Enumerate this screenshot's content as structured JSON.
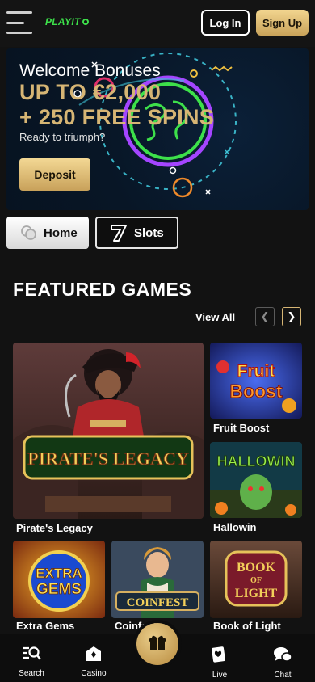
{
  "header": {
    "logo_text": "PLAYIT",
    "login_label": "Log In",
    "signup_label": "Sign Up"
  },
  "banner": {
    "welcome": "Welcome Bonuses",
    "amount": "UP TO €2,000",
    "spins": "+ 250 FREE SPINS",
    "tagline": "Ready to triumph?",
    "deposit_label": "Deposit"
  },
  "tabs": [
    {
      "label": "Home",
      "icon": "chips-icon",
      "active": true
    },
    {
      "label": "Slots",
      "icon": "seven-icon",
      "active": false
    }
  ],
  "featured": {
    "title": "FEATURED GAMES",
    "view_all": "View All",
    "games": [
      {
        "name": "Pirate's Legacy",
        "art_text": "PIRATE'S LEGACY"
      },
      {
        "name": "Fruit Boost",
        "art_text": "Fruit Boost"
      },
      {
        "name": "Hallowin",
        "art_text": "HALLOWIN"
      },
      {
        "name": "Extra Gems",
        "art_text": "EXTRA GEMS"
      },
      {
        "name": "Coinfest",
        "art_text": "COINFEST"
      },
      {
        "name": "Book of Light",
        "art_text": "BOOK OF LIGHT"
      }
    ]
  },
  "bottom_nav": {
    "items": [
      {
        "label": "Search",
        "icon": "search-icon"
      },
      {
        "label": "Casino",
        "icon": "casino-icon"
      },
      {
        "label": "Live",
        "icon": "cards-icon"
      },
      {
        "label": "Chat",
        "icon": "chat-icon"
      }
    ],
    "center_icon": "gift-icon"
  },
  "colors": {
    "gold": "#d6b574",
    "brand_green": "#3de04a",
    "background": "#121212"
  }
}
